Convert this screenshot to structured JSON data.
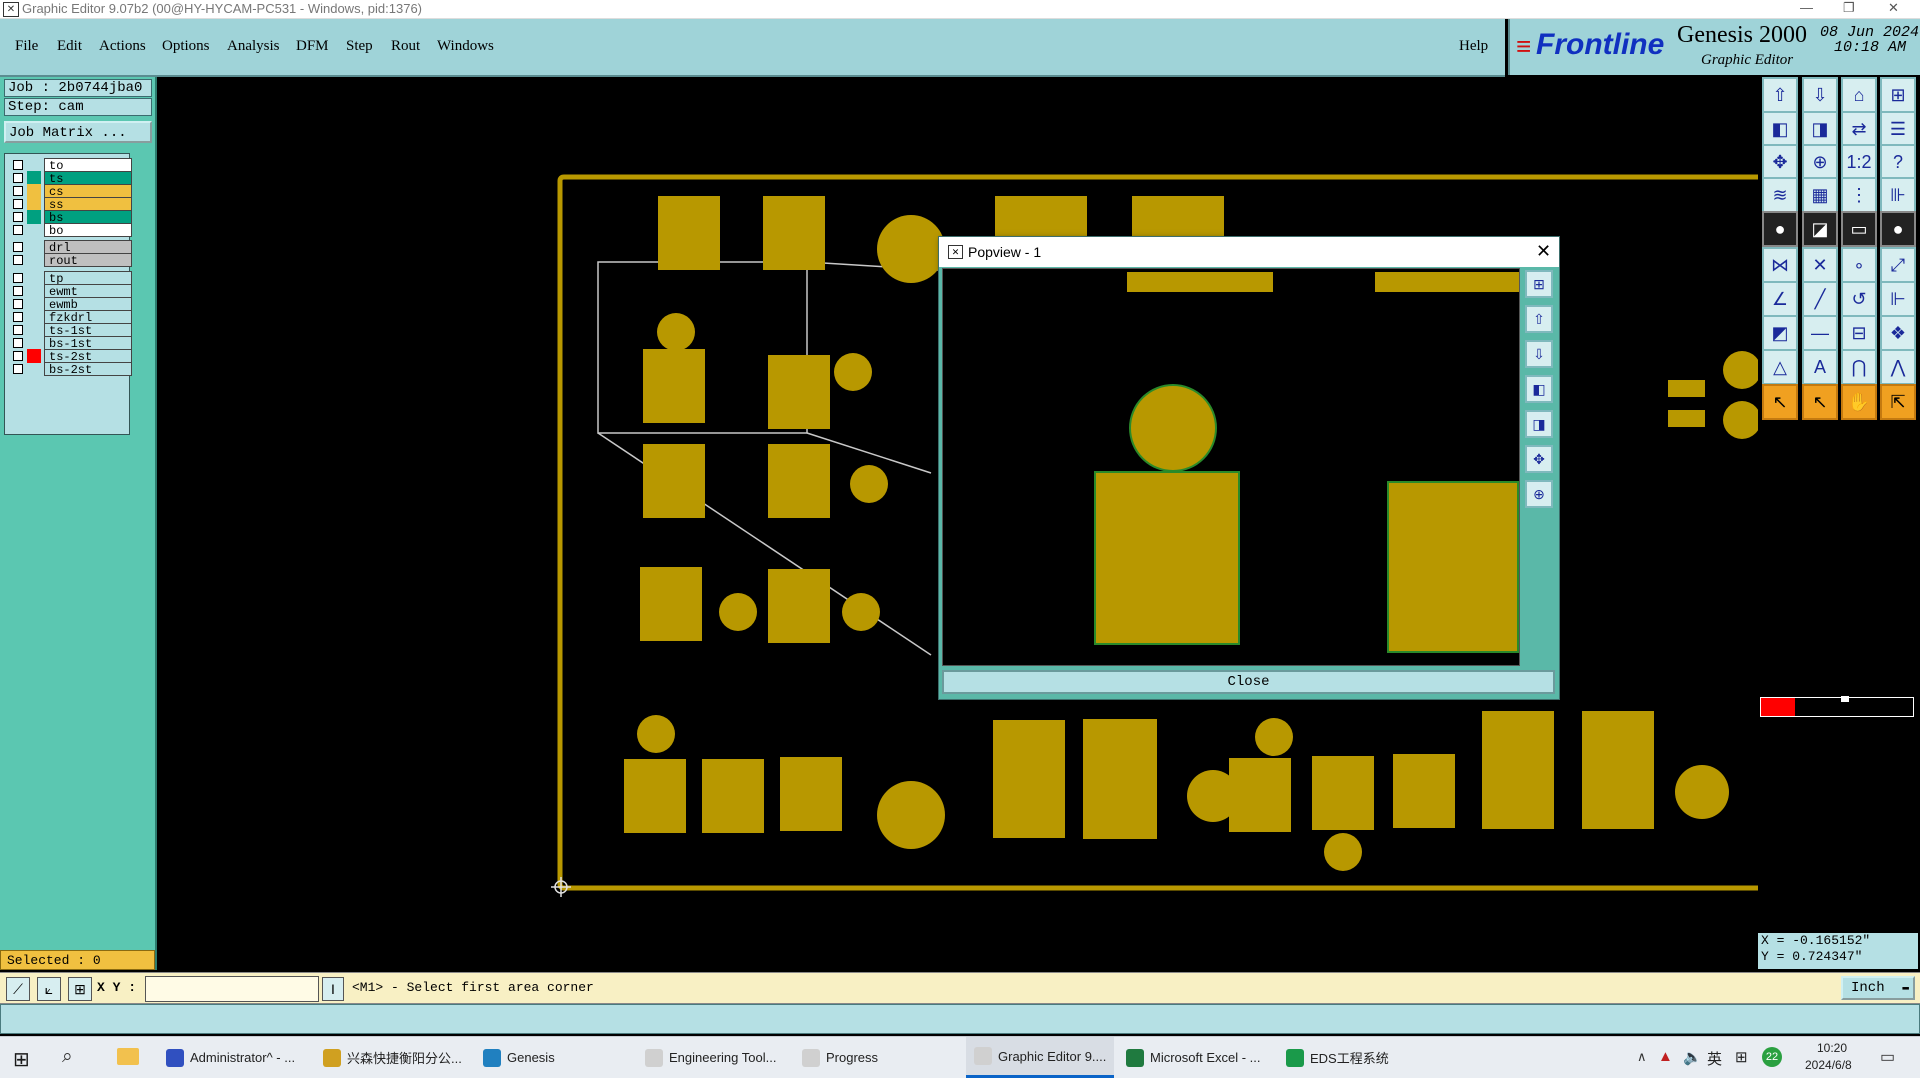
{
  "window": {
    "title": "Graphic Editor 9.07b2 (00@HY-HYCAM-PC531 - Windows, pid:1376)"
  },
  "menu": {
    "items": [
      "File",
      "Edit",
      "Actions",
      "Options",
      "Analysis",
      "DFM",
      "Step",
      "Rout",
      "Windows"
    ],
    "help": "Help"
  },
  "brand": {
    "logo": "Frontline",
    "product": "Genesis 2000",
    "subtitle": "Graphic Editor",
    "date": "08 Jun 2024",
    "time": "10:18 AM"
  },
  "job": {
    "job_label": "Job : 2b0744jba0",
    "step_label": "Step: cam",
    "matrix_button": "Job Matrix ..."
  },
  "layers": [
    {
      "name": "to",
      "color": "#ffffff",
      "bg": "#ffffff"
    },
    {
      "name": "ts",
      "color": "#00a080",
      "bg": "#00a080",
      "active": true
    },
    {
      "name": "cs",
      "color": "#f0c040",
      "bg": "#f0c040"
    },
    {
      "name": "ss",
      "color": "#f0c040",
      "bg": "#f0c040"
    },
    {
      "name": "bs",
      "color": "#00a080",
      "bg": "#00a080"
    },
    {
      "name": "bo",
      "color": "#ffffff",
      "bg": "#ffffff"
    },
    {
      "name": "drl",
      "color": "#c0c0c0",
      "bg": "#c0c0c0"
    },
    {
      "name": "rout",
      "color": "#c0c0c0",
      "bg": "#c0c0c0"
    },
    {
      "name": "tp",
      "color": "#b5e0e4",
      "bg": "#b5e0e4"
    },
    {
      "name": "ewmt",
      "color": "#b5e0e4",
      "bg": "#b5e0e4"
    },
    {
      "name": "ewmb",
      "color": "#b5e0e4",
      "bg": "#b5e0e4"
    },
    {
      "name": "fzkdrl",
      "color": "#b5e0e4",
      "bg": "#b5e0e4"
    },
    {
      "name": "ts-1st",
      "color": "#b5e0e4",
      "bg": "#b5e0e4"
    },
    {
      "name": "bs-1st",
      "color": "#b5e0e4",
      "bg": "#b5e0e4"
    },
    {
      "name": "ts-2st",
      "color": "#ff0000",
      "bg": "#b5e0e4"
    },
    {
      "name": "bs-2st",
      "color": "#b5e0e4",
      "bg": "#b5e0e4"
    }
  ],
  "status": {
    "selected": "Selected : 0",
    "xy_label": "X Y :",
    "prompt": "<M1> - Select first area corner",
    "units": "Inch",
    "coord_x": "X = -0.165152\"",
    "coord_y": "Y = 0.724347\""
  },
  "popview": {
    "title": "Popview - 1",
    "close_button": "Close"
  },
  "taskbar": {
    "items": [
      "Administrator^ - ...",
      "兴森快捷衡阳分公...",
      "Genesis",
      "Engineering Tool...",
      "Progress",
      "Graphic Editor 9....",
      "Microsoft Excel - ...",
      "EDS工程系统"
    ],
    "tray_lang": "英",
    "tray_badge": "22",
    "clock_time": "10:20",
    "clock_date": "2024/6/8"
  },
  "colors": {
    "pad": "#b89800",
    "menu_bg": "#9fd3d8",
    "panel_bg": "#5bc7b1",
    "selected_bg": "#f0c040"
  }
}
